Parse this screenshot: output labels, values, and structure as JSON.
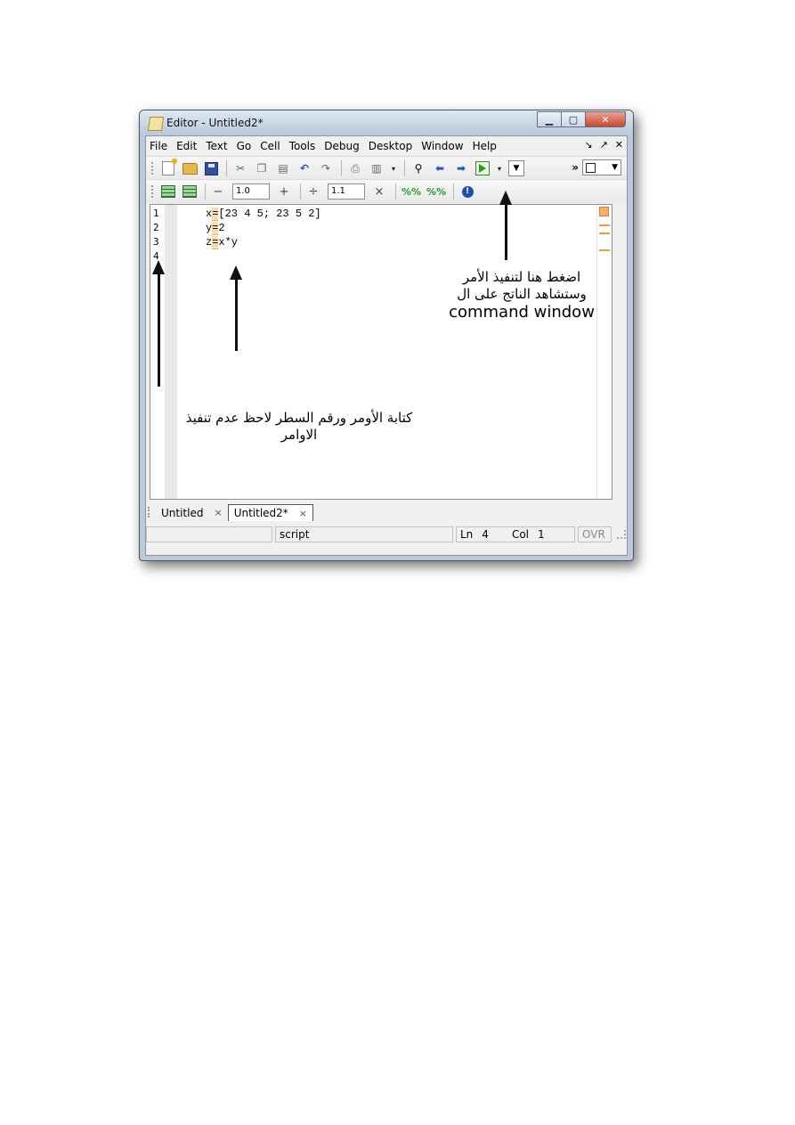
{
  "window": {
    "title": "Editor - Untitled2*",
    "controls": {
      "minimize": "▁",
      "maximize": "▢",
      "close": "✕"
    }
  },
  "menu": {
    "items": [
      "File",
      "Edit",
      "Text",
      "Go",
      "Cell",
      "Tools",
      "Debug",
      "Desktop",
      "Window",
      "Help"
    ],
    "right_icons": [
      "↘",
      "↗",
      "✕"
    ]
  },
  "toolbar2": {
    "decrement": "−",
    "value1": "1.0",
    "increment": "+",
    "divide": "÷",
    "value2": "1.1",
    "multiply": "×"
  },
  "editor": {
    "line_numbers": [
      "1",
      "2",
      "3",
      "4"
    ],
    "lines": [
      {
        "var": "x",
        "eq": "=",
        "expr": "[23 4 5; 23 5 2]"
      },
      {
        "var": "y",
        "eq": "=",
        "expr": "2"
      },
      {
        "var": "z",
        "eq": "=",
        "expr": "x*y"
      }
    ]
  },
  "tabs": [
    {
      "label": "Untitled",
      "close": "×",
      "active": false
    },
    {
      "label": "Untitled2*",
      "close": "×",
      "active": true
    }
  ],
  "status": {
    "mode": "script",
    "ln_label": "Ln",
    "ln_value": "4",
    "col_label": "Col",
    "col_value": "1",
    "ovr": "OVR"
  },
  "annotations": {
    "run_note_line1": "اضغط هنا لتنفيذ الأمر",
    "run_note_line2": "وستشاهد الناتج على ال",
    "run_note_line3": "command window",
    "write_note_line1": "كتابة الأومر ورقم السطر لاحظ عدم تنفيذ",
    "write_note_line2": "الاوامر"
  },
  "colors": {
    "marker_orange": "#f19b3e",
    "highlight": "#f6dcb0",
    "run_green": "#2e9a1e"
  },
  "icons": [
    "new-file-icon",
    "open-folder-icon",
    "save-icon",
    "cut-icon",
    "copy-icon",
    "paste-icon",
    "undo-icon",
    "redo-icon",
    "print-icon",
    "find-icon",
    "back-icon",
    "forward-icon",
    "run-icon",
    "cell-icon",
    "info-icon"
  ]
}
